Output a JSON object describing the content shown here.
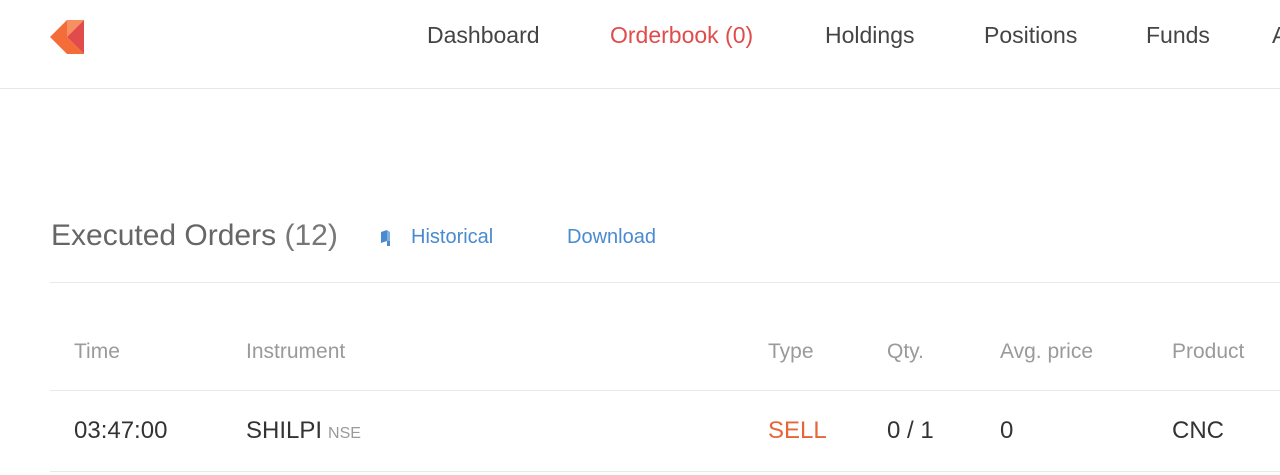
{
  "nav": {
    "items": [
      {
        "label": "Dashboard",
        "active": false
      },
      {
        "label": "Orderbook (0)",
        "active": true
      },
      {
        "label": "Holdings",
        "active": false
      },
      {
        "label": "Positions",
        "active": false
      },
      {
        "label": "Funds",
        "active": false
      },
      {
        "label": "A",
        "active": false
      }
    ]
  },
  "colors": {
    "brand_orange": "#f46c38",
    "brand_red": "#e14b4b",
    "link_blue": "#4a8ad0",
    "sell": "#e8653a"
  },
  "section": {
    "title": "Executed Orders",
    "count": "(12)",
    "historical_label": "Historical",
    "historical_icon": "book-icon",
    "download_label": "Download"
  },
  "table": {
    "headers": [
      "Time",
      "Instrument",
      "Type",
      "Qty.",
      "Avg. price",
      "Product"
    ],
    "rows": [
      {
        "time": "03:47:00",
        "instrument": "SHILPI",
        "exchange": "NSE",
        "type": "SELL",
        "qty": "0 / 1",
        "avg_price": "0",
        "product": "CNC"
      }
    ]
  }
}
